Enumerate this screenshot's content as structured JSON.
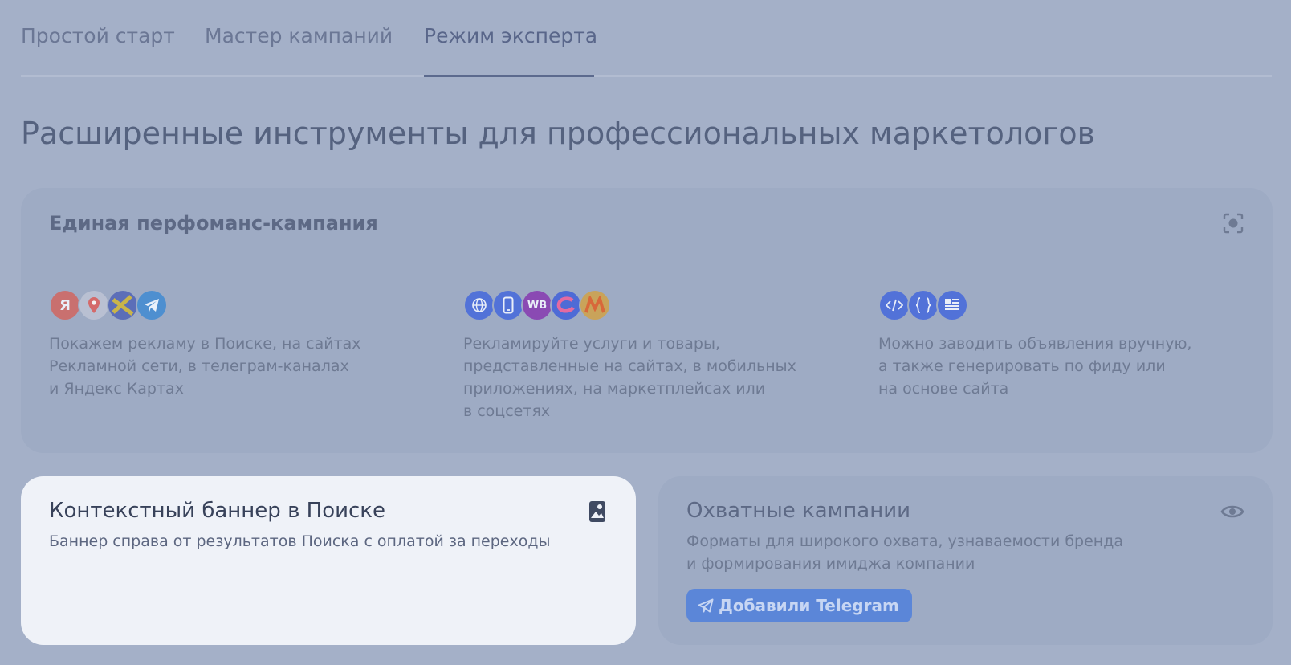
{
  "tabs": [
    {
      "label": "Простой старт"
    },
    {
      "label": "Мастер кампаний"
    },
    {
      "label": "Режим эксперта",
      "active": true
    }
  ],
  "headline": "Расширенные инструменты для профессиональных маркетологов",
  "performance_card": {
    "title": "Единая перфоманс-кампания",
    "corner_icon": "focus-target-icon",
    "columns": [
      {
        "icons": [
          "yandex-icon",
          "map-pin-icon",
          "network-icon",
          "telegram-icon"
        ],
        "icon_letters": [
          "Я"
        ],
        "text": "Покажем рекламу в Поиске, на сайтах\nРекламной сети, в телеграм-каналах\nи Яндекс Картах"
      },
      {
        "icons": [
          "globe-icon",
          "mobile-app-icon",
          "wildberries-icon",
          "ozon-icon",
          "yandex-market-icon"
        ],
        "icon_letters": [
          "WB"
        ],
        "text": "Рекламируйте услуги и товары,\nпредставленные на сайтах, в мобильных\nприложениях, на маркетплейсах или\nв соцсетях"
      },
      {
        "icons": [
          "code-icon",
          "braces-icon",
          "document-list-icon"
        ],
        "text": "Можно заводить объявления вручную,\nа также генерировать по фиду или\nна основе сайта"
      }
    ]
  },
  "banner_card": {
    "title": "Контекстный баннер в Поиске",
    "subtitle": "Баннер справа от результатов Поиска с оплатой за переходы",
    "corner_icon": "image-icon"
  },
  "reach_card": {
    "title": "Охватные кампании",
    "subtitle": "Форматы для широкого охвата, узнаваемости бренда\nи формирования имиджа компании",
    "corner_icon": "eye-icon",
    "badge": "Добавили Telegram"
  },
  "colors": {
    "background": "#a4b0c8",
    "card_muted": "#9eabc4",
    "card_active": "#eff2f8",
    "accent_button": "#5b86d8",
    "icon_blue": "#5272d8"
  }
}
